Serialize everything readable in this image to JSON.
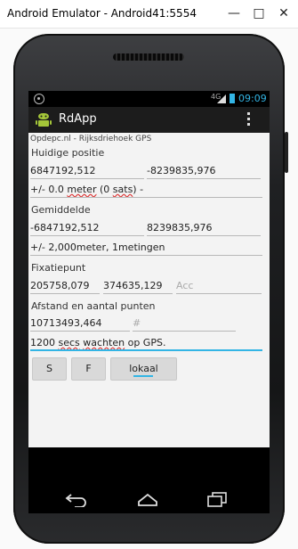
{
  "window": {
    "title": "Android Emulator - Android41:5554",
    "minimize_glyph": "—",
    "maximize_glyph": "□",
    "close_glyph": "✕"
  },
  "status_bar": {
    "network": "4G",
    "time": "09:09",
    "icons": [
      "gps-icon",
      "signal-icon",
      "battery-icon"
    ]
  },
  "action_bar": {
    "app_title": "RdApp",
    "app_icon": "android-icon",
    "overflow_icon": "overflow-menu-icon"
  },
  "content": {
    "header": "Opdepc.nl - Rijksdriehoek GPS",
    "current_position": {
      "label": "Huidige positie",
      "x": "6847192,512",
      "y": "-8239835,976",
      "accuracy_prefix": "+/- 0.0 ",
      "accuracy_word": "meter",
      "accuracy_suffix": " (0 ",
      "sats_word": "sats",
      "accuracy_end": ") -"
    },
    "average": {
      "label": "Gemiddelde",
      "x": "-6847192,512",
      "y": "8239835,976",
      "accuracy": "+/-  2,000meter, 1metingen"
    },
    "fixpoint": {
      "label": "Fixatiepunt",
      "x": "205758,079",
      "y": "374635,129",
      "acc_placeholder": "Acc"
    },
    "distance": {
      "label": "Afstand en aantal punten",
      "distance_value": "10713493,464",
      "count_placeholder": "#"
    },
    "message": {
      "prefix": "1200 ",
      "word_secs": "secs",
      "middle": " ",
      "word_wachten": "wachten",
      "suffix": " op GPS."
    },
    "buttons": {
      "s": "S",
      "f": "F",
      "lokaal": "lokaal"
    }
  },
  "nav_bar": {
    "icons": [
      "back-icon",
      "home-icon",
      "recent-apps-icon"
    ]
  },
  "colors": {
    "accent": "#33b5e5",
    "action_bar": "#1c1c1c",
    "content_bg": "#f3f3f3",
    "spell_error": "#dd3333"
  }
}
